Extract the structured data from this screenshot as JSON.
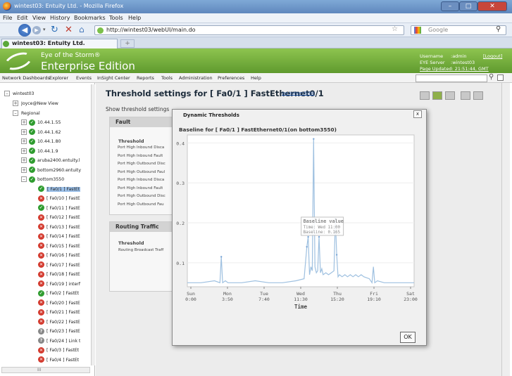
{
  "browser": {
    "window_title": "wintest03: Entuity Ltd. - Mozilla Firefox",
    "menu": [
      "File",
      "Edit",
      "View",
      "History",
      "Bookmarks",
      "Tools",
      "Help"
    ],
    "url": "http://wintest03/webUI/main.do",
    "search_placeholder": "Google",
    "tab_label": "wintest03: Entuity Ltd.",
    "new_tab_symbol": "+"
  },
  "app": {
    "brand_line1": "Eye of the Storm®",
    "brand_line2": "Enterprise Edition",
    "username_label": "Username",
    "username_value": ":admin",
    "logout": "[Logout]",
    "server_label": "EYE Server",
    "server_value": ":wintest03",
    "page_updated": "Page Updated: 21:51:44, GMT",
    "menu": [
      "Network Dashboards",
      "Explorer",
      "Events",
      "InSight Center",
      "Reports",
      "Tools",
      "Administration",
      "Preferences",
      "Help"
    ]
  },
  "sidebar": {
    "root": "wintest03",
    "items": [
      {
        "label": "Joyce@New View",
        "status": "none",
        "expander": "+"
      },
      {
        "label": "Regional",
        "status": "none",
        "expander": "-"
      },
      {
        "label": "10.44.1.55",
        "status": "ok",
        "expander": "+"
      },
      {
        "label": "10.44.1.62",
        "status": "ok",
        "expander": "+"
      },
      {
        "label": "10.44.1.80",
        "status": "ok",
        "expander": "+"
      },
      {
        "label": "10.44.1.9",
        "status": "ok",
        "expander": "+"
      },
      {
        "label": "aruba2400.entuity.l",
        "status": "ok",
        "expander": "+"
      },
      {
        "label": "bottom2960.entuity",
        "status": "ok",
        "expander": "+"
      },
      {
        "label": "bottom3550",
        "status": "ok",
        "expander": "-"
      },
      {
        "label": "[ Fa0/1 ] FastEt",
        "status": "ok",
        "expander": ""
      },
      {
        "label": "[ Fa0/10 ] FastE",
        "status": "err",
        "expander": ""
      },
      {
        "label": "[ Fa0/11 ] FastE",
        "status": "ok",
        "expander": ""
      },
      {
        "label": "[ Fa0/12 ] FastE",
        "status": "err",
        "expander": ""
      },
      {
        "label": "[ Fa0/13 ] FastE",
        "status": "err",
        "expander": ""
      },
      {
        "label": "[ Fa0/14 ] FastE",
        "status": "err",
        "expander": ""
      },
      {
        "label": "[ Fa0/15 ] FastE",
        "status": "err",
        "expander": ""
      },
      {
        "label": "[ Fa0/16 ] FastE",
        "status": "err",
        "expander": ""
      },
      {
        "label": "[ Fa0/17 ] FastE",
        "status": "err",
        "expander": ""
      },
      {
        "label": "[ Fa0/18 ] FastE",
        "status": "err",
        "expander": ""
      },
      {
        "label": "[ Fa0/19 ] interf",
        "status": "err",
        "expander": ""
      },
      {
        "label": "[ Fa0/2 ] FastEt",
        "status": "ok",
        "expander": ""
      },
      {
        "label": "[ Fa0/20 ] FastE",
        "status": "err",
        "expander": ""
      },
      {
        "label": "[ Fa0/21 ] FastE",
        "status": "err",
        "expander": ""
      },
      {
        "label": "[ Fa0/22 ] FastE",
        "status": "err",
        "expander": ""
      },
      {
        "label": "[ Fa0/23 ] FastE",
        "status": "unk",
        "expander": ""
      },
      {
        "label": "[ Fa0/24 ] Link t",
        "status": "unk",
        "expander": ""
      },
      {
        "label": "[ Fa0/3 ] FastEt",
        "status": "err",
        "expander": ""
      },
      {
        "label": "[ Fa0/4 ] FastEt",
        "status": "err",
        "expander": ""
      }
    ],
    "scroll_label": "III"
  },
  "page": {
    "title": "Threshold settings for [ Fa0/1 ] FastEthernet0/1",
    "title_link": "(on bottom3550)",
    "show_label": "Show threshold settings",
    "fault_panel": {
      "header": "Fault",
      "threshold_label": "Threshold",
      "rows": [
        "Port High Inbound Disca",
        "Port High Inbound Fault",
        "Port High Outbound Disc",
        "Port High Outbound Faul",
        "Port High Inbound Disca",
        "Port High Inbound Fault",
        "Port High Outbound Disc",
        "Port High Outbound Fau"
      ]
    },
    "routing_panel": {
      "header": "Routing Traffic",
      "threshold_label": "Threshold",
      "rows": [
        "Routing Broadcast Traff"
      ]
    }
  },
  "modal": {
    "title": "Dynamic Thresholds",
    "close": "x",
    "ok": "OK"
  },
  "chart_data": {
    "type": "line",
    "title": "Baseline for [ Fa0/1 ] FastEthernet0/1(on bottom3550)",
    "xlabel": "Time",
    "ylabel": "",
    "x_ticks": [
      [
        "Sun",
        "0:00"
      ],
      [
        "Mon",
        "3:50"
      ],
      [
        "Tue",
        "7:40"
      ],
      [
        "Wed",
        "11:30"
      ],
      [
        "Thu",
        "15:20"
      ],
      [
        "Fri",
        "19:10"
      ],
      [
        "Sat",
        "23:00"
      ]
    ],
    "y_ticks": [
      "0.1",
      "0.2",
      "0.3",
      "0.4"
    ],
    "ylim": [
      0.04,
      0.42
    ],
    "xlim": [
      0,
      167
    ],
    "series_color": "#9ec0e0",
    "series": [
      {
        "x": [
          0,
          10,
          20,
          24,
          25,
          26,
          28,
          30,
          40,
          50,
          60,
          70,
          80,
          86,
          88,
          89,
          90,
          91,
          92,
          93,
          94,
          95,
          96,
          97,
          98,
          99,
          100,
          102,
          104,
          106,
          108,
          109,
          110,
          111,
          112,
          114,
          116,
          118,
          120,
          122,
          124,
          126,
          128,
          130,
          134,
          136,
          137,
          138,
          140,
          145,
          150,
          160,
          167
        ],
        "y": [
          0.05,
          0.05,
          0.055,
          0.05,
          0.115,
          0.05,
          0.055,
          0.05,
          0.05,
          0.055,
          0.05,
          0.05,
          0.055,
          0.06,
          0.14,
          0.165,
          0.07,
          0.09,
          0.08,
          0.41,
          0.09,
          0.075,
          0.08,
          0.165,
          0.075,
          0.085,
          0.07,
          0.075,
          0.07,
          0.075,
          0.08,
          0.21,
          0.12,
          0.065,
          0.07,
          0.065,
          0.07,
          0.065,
          0.07,
          0.065,
          0.07,
          0.065,
          0.07,
          0.065,
          0.06,
          0.05,
          0.09,
          0.05,
          0.055,
          0.05,
          0.05,
          0.05,
          0.05
        ]
      }
    ],
    "tooltip": {
      "title": "Baseline value",
      "line1": "Time: Wed 11:00",
      "line2": "Baseline: 0.165",
      "x": 89,
      "y": 0.165
    }
  }
}
